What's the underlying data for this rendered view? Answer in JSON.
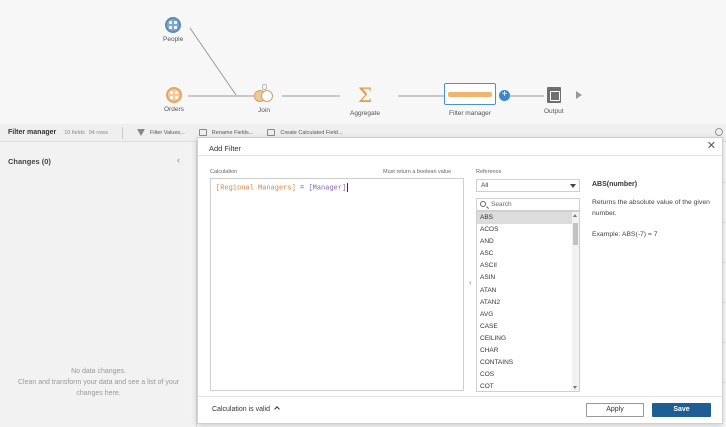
{
  "flow": {
    "nodes": {
      "people": "People",
      "orders": "Orders",
      "join": "Join",
      "aggregate": "Aggregate",
      "filter": "Filter manager",
      "output": "Output"
    }
  },
  "profile_bar": {
    "title": "Filter manager",
    "fields": "10 fields",
    "rows": "94 rows",
    "filter_values": "Filter Values...",
    "rename_fields": "Rename Fields...",
    "create_calc": "Create Calculated Field..."
  },
  "changes": {
    "title": "Changes (0)",
    "empty_line1": "No data changes.",
    "empty_line2": "Clean and transform your data and see a list of your",
    "empty_line3": "changes here."
  },
  "dialog": {
    "title": "Add Filter",
    "calc_label": "Calculation",
    "calc_hint": "Must return a boolean value",
    "expr_field1": "[Regional Managers]",
    "expr_op": " = ",
    "expr_field2": "[Manager]",
    "ref_label": "Reference",
    "ref_selected": "All",
    "search_placeholder": "Search",
    "functions": [
      "ABS",
      "ACOS",
      "AND",
      "ASC",
      "ASCII",
      "ASIN",
      "ATAN",
      "ATAN2",
      "AVG",
      "CASE",
      "CEILING",
      "CHAR",
      "CONTAINS",
      "COS",
      "COT"
    ],
    "help_title": "ABS(number)",
    "help_desc": "Returns the absolute value of the given number.",
    "help_example": "Example: ABS(-7) = 7",
    "valid_text": "Calculation is valid",
    "apply": "Apply",
    "save": "Save"
  },
  "colors": {
    "save_button": "#1f5e94",
    "field_orange": "#e0833e",
    "field_purple": "#8b61b8",
    "selection_blue": "#4a90d9"
  }
}
